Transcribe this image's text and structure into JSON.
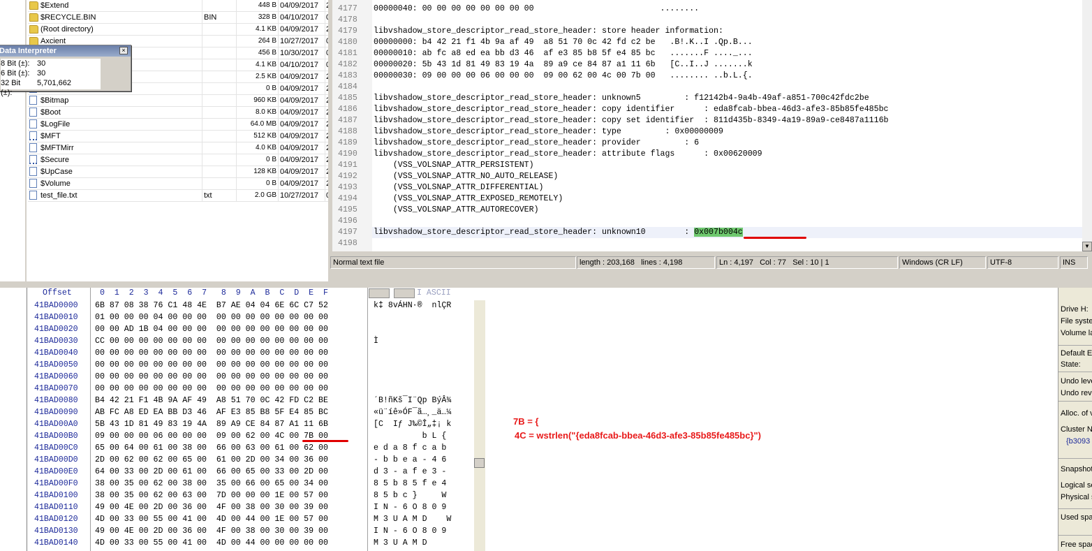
{
  "files": [
    {
      "name": "$Extend",
      "ext": "",
      "size": "448 B",
      "date": "04/09/2017",
      "rest": "2",
      "icon": "folder"
    },
    {
      "name": "$RECYCLE.BIN",
      "ext": "BIN",
      "size": "328 B",
      "date": "04/10/2017",
      "rest": "0",
      "icon": "folder"
    },
    {
      "name": "(Root directory)",
      "ext": "",
      "size": "4.1 KB",
      "date": "04/09/2017",
      "rest": "2",
      "icon": "folder"
    },
    {
      "name": "Axcient",
      "ext": "",
      "size": "264 B",
      "date": "10/27/2017",
      "rest": "0",
      "icon": "folder"
    },
    {
      "name": "",
      "ext": "",
      "size": "456 B",
      "date": "10/30/2017",
      "rest": "0",
      "icon": "folder"
    },
    {
      "name": "",
      "ext": "",
      "size": "4.1 KB",
      "date": "04/10/2017",
      "rest": "0",
      "icon": "folder"
    },
    {
      "name": "",
      "ext": "",
      "size": "2.5 KB",
      "date": "04/09/2017",
      "rest": "2",
      "icon": "folder"
    },
    {
      "name": "",
      "ext": "",
      "size": "0 B",
      "date": "04/09/2017",
      "rest": "2",
      "icon": "file"
    },
    {
      "name": "$Bitmap",
      "ext": "",
      "size": "960 KB",
      "date": "04/09/2017",
      "rest": "2",
      "icon": "file"
    },
    {
      "name": "$Boot",
      "ext": "",
      "size": "8.0 KB",
      "date": "04/09/2017",
      "rest": "2",
      "icon": "file"
    },
    {
      "name": "$LogFile",
      "ext": "",
      "size": "64.0 MB",
      "date": "04/09/2017",
      "rest": "2",
      "icon": "file"
    },
    {
      "name": "$MFT",
      "ext": "",
      "size": "512 KB",
      "date": "04/09/2017",
      "rest": "2",
      "icon": "file-dotted"
    },
    {
      "name": "$MFTMirr",
      "ext": "",
      "size": "4.0 KB",
      "date": "04/09/2017",
      "rest": "2",
      "icon": "file"
    },
    {
      "name": "$Secure",
      "ext": "",
      "size": "0 B",
      "date": "04/09/2017",
      "rest": "2",
      "icon": "file-dotted"
    },
    {
      "name": "$UpCase",
      "ext": "",
      "size": "128 KB",
      "date": "04/09/2017",
      "rest": "2",
      "icon": "file"
    },
    {
      "name": "$Volume",
      "ext": "",
      "size": "0 B",
      "date": "04/09/2017",
      "rest": "2",
      "icon": "file"
    },
    {
      "name": "test_file.txt",
      "ext": "txt",
      "size": "2.0 GB",
      "date": "10/27/2017",
      "rest": "0",
      "icon": "file"
    }
  ],
  "data_interpreter": {
    "title": "Data Interpreter",
    "close": "×",
    "rows": [
      {
        "label": "8 Bit (±):",
        "value": "30"
      },
      {
        "label": "6 Bit (±):",
        "value": "30"
      },
      {
        "label": "32 Bit (±):",
        "value": "5,701,662"
      }
    ]
  },
  "editor": {
    "lines": [
      {
        "num": "4177",
        "text": "00000040: 00 00 00 00 00 00 00 00                          ........"
      },
      {
        "num": "4178",
        "text": ""
      },
      {
        "num": "4179",
        "text": "libvshadow_store_descriptor_read_store_header: store header information:"
      },
      {
        "num": "4180",
        "text": "00000000: b4 42 21 f1 4b 9a af 49  a8 51 70 0c 42 fd c2 be   .B!.K..I .Qp.B..."
      },
      {
        "num": "4181",
        "text": "00000010: ab fc a8 ed ea bb d3 46  af e3 85 b8 5f e4 85 bc   .......F ...._..."
      },
      {
        "num": "4182",
        "text": "00000020: 5b 43 1d 81 49 83 19 4a  89 a9 ce 84 87 a1 11 6b   [C..I..J .......k"
      },
      {
        "num": "4183",
        "text": "00000030: 09 00 00 00 06 00 00 00  09 00 62 00 4c 00 7b 00   ........ ..b.L.{."
      },
      {
        "num": "4184",
        "text": ""
      },
      {
        "num": "4185",
        "text": "libvshadow_store_descriptor_read_store_header: unknown5         : f12142b4-9a4b-49af-a851-700c42fdc2be"
      },
      {
        "num": "4186",
        "text": "libvshadow_store_descriptor_read_store_header: copy identifier      : eda8fcab-bbea-46d3-afe3-85b85fe485bc"
      },
      {
        "num": "4187",
        "text": "libvshadow_store_descriptor_read_store_header: copy set identifier  : 811d435b-8349-4a19-89a9-ce8487a1116b"
      },
      {
        "num": "4188",
        "text": "libvshadow_store_descriptor_read_store_header: type         : 0x00000009"
      },
      {
        "num": "4189",
        "text": "libvshadow_store_descriptor_read_store_header: provider         : 6"
      },
      {
        "num": "4190",
        "text": "libvshadow_store_descriptor_read_store_header: attribute flags      : 0x00620009"
      },
      {
        "num": "4191",
        "text": "    (VSS_VOLSNAP_ATTR_PERSISTENT)"
      },
      {
        "num": "4192",
        "text": "    (VSS_VOLSNAP_ATTR_NO_AUTO_RELEASE)"
      },
      {
        "num": "4193",
        "text": "    (VSS_VOLSNAP_ATTR_DIFFERENTIAL)"
      },
      {
        "num": "4194",
        "text": "    (VSS_VOLSNAP_ATTR_EXPOSED_REMOTELY)"
      },
      {
        "num": "4195",
        "text": "    (VSS_VOLSNAP_ATTR_AUTORECOVER)"
      },
      {
        "num": "4196",
        "text": ""
      }
    ],
    "current_line": {
      "num": "4197",
      "prefix": "libvshadow_store_descriptor_read_store_header: unknown10        : ",
      "highlight": "0x007b004c"
    },
    "last_line": {
      "num": "4198",
      "text": ""
    },
    "status": {
      "type": "Normal text file",
      "length": "length : 203,168",
      "lines": "lines : 4,198",
      "ln": "Ln : 4,197",
      "col": "Col : 77",
      "sel": "Sel : 10 | 1",
      "eol": "Windows (CR LF)",
      "encoding": "UTF-8",
      "mode": "INS"
    }
  },
  "hex": {
    "header_offset": "Offset",
    "header_cols": "0  1  2  3  4  5  6  7   8  9  A  B  C  D  E  F",
    "header_ascii": "I ASCII",
    "rows": [
      {
        "off": "41BAD0000",
        "bytes": "6B 87 08 38 76 C1 48 4E  B7 AE 04 04 6E 6C C7 52",
        "ascii": "k‡ 8vÁHN·®  nlÇR"
      },
      {
        "off": "41BAD0010",
        "bytes": "01 00 00 00 04 00 00 00  00 00 00 00 00 00 00 00",
        "ascii": ""
      },
      {
        "off": "41BAD0020",
        "bytes": "00 00 AD 1B 04 00 00 00  00 00 00 00 00 00 00 00",
        "ascii": "  ­"
      },
      {
        "off": "41BAD0030",
        "bytes": "CC 00 00 00 00 00 00 00  00 00 00 00 00 00 00 00",
        "ascii": "Ì"
      },
      {
        "off": "41BAD0040",
        "bytes": "00 00 00 00 00 00 00 00  00 00 00 00 00 00 00 00",
        "ascii": ""
      },
      {
        "off": "41BAD0050",
        "bytes": "00 00 00 00 00 00 00 00  00 00 00 00 00 00 00 00",
        "ascii": ""
      },
      {
        "off": "41BAD0060",
        "bytes": "00 00 00 00 00 00 00 00  00 00 00 00 00 00 00 00",
        "ascii": ""
      },
      {
        "off": "41BAD0070",
        "bytes": "00 00 00 00 00 00 00 00  00 00 00 00 00 00 00 00",
        "ascii": ""
      },
      {
        "off": "41BAD0080",
        "bytes": "B4 42 21 F1 4B 9A AF 49  A8 51 70 0C 42 FD C2 BE",
        "ascii": "´B!ñKš¯I¨Qp BýÂ¾"
      },
      {
        "off": "41BAD0090",
        "bytes": "AB FC A8 ED EA BB D3 46  AF E3 85 B8 5F E4 85 BC",
        "ascii": "«ü¨íê»ÓF¯ã…¸_ä…¼"
      },
      {
        "off": "41BAD00A0",
        "bytes": "5B 43 1D 81 49 83 19 4A  89 A9 CE 84 87 A1 11 6B",
        "ascii": "[C  Iƒ J‰©Î„‡¡ k"
      },
      {
        "off": "41BAD00B0",
        "bytes": "09 00 00 00 06 00 00 00  09 00 62 00 4C 00 7B 00",
        "ascii": "          b L {"
      },
      {
        "off": "41BAD00C0",
        "bytes": "65 00 64 00 61 00 38 00  66 00 63 00 61 00 62 00",
        "ascii": "e d a 8 f c a b"
      },
      {
        "off": "41BAD00D0",
        "bytes": "2D 00 62 00 62 00 65 00  61 00 2D 00 34 00 36 00",
        "ascii": "- b b e a - 4 6"
      },
      {
        "off": "41BAD00E0",
        "bytes": "64 00 33 00 2D 00 61 00  66 00 65 00 33 00 2D 00",
        "ascii": "d 3 - a f e 3 -"
      },
      {
        "off": "41BAD00F0",
        "bytes": "38 00 35 00 62 00 38 00  35 00 66 00 65 00 34 00",
        "ascii": "8 5 b 8 5 f e 4"
      },
      {
        "off": "41BAD0100",
        "bytes": "38 00 35 00 62 00 63 00  7D 00 00 00 1E 00 57 00",
        "ascii": "8 5 b c }     W"
      },
      {
        "off": "41BAD0110",
        "bytes": "49 00 4E 00 2D 00 36 00  4F 00 38 00 30 00 39 00",
        "ascii": "I N - 6 O 8 0 9"
      },
      {
        "off": "41BAD0120",
        "bytes": "4D 00 33 00 55 00 41 00  4D 00 44 00 1E 00 57 00",
        "ascii": "M 3 U A M D    W"
      },
      {
        "off": "41BAD0130",
        "bytes": "49 00 4E 00 2D 00 36 00  4F 00 38 00 30 00 39 00",
        "ascii": "I N - 6 O 8 0 9"
      },
      {
        "off": "41BAD0140",
        "bytes": "4D 00 33 00 55 00 41 00  4D 00 44 00 00 00 00 00",
        "ascii": "M 3 U A M D"
      }
    ]
  },
  "annotations": {
    "line1": "7B = {",
    "line2": "4C = wstrlen(\"{eda8fcab-bbea-46d3-afe3-85b85fe485bc}\")"
  },
  "info_panel": {
    "items": [
      "Drive H:",
      "File syste",
      "Volume la",
      "Default E",
      "State:",
      "Undo leve",
      "Undo reve",
      "Alloc. of v",
      "Cluster N",
      "{b3093",
      "Snapshot",
      "Logical se",
      "Physical s",
      "Used spac",
      "Free spac"
    ]
  },
  "colors": {
    "hex_offset": "#1d2a9a",
    "annotation_red": "#e81a1a",
    "highlight_green": "#6ec86e",
    "chrome": "#d4d0c8"
  }
}
